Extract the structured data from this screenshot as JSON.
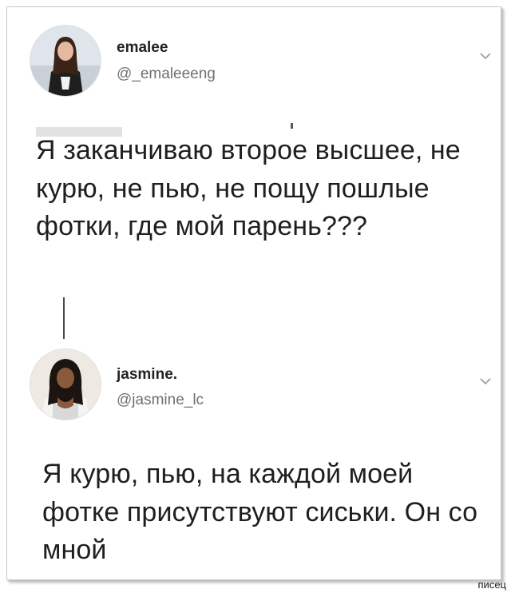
{
  "tweet1": {
    "name": "emalee",
    "handle": "@_emaleeeng",
    "text": "Я заканчиваю второе высшее, не курю, не пью, не пощу пошлые фотки, где мой парень???",
    "menu_icon": "chevron-down-icon",
    "avatar_icon": "user-photo"
  },
  "tweet2": {
    "name": "jasmine.",
    "handle": "@jasmine_lc",
    "text": "Я курю, пью, на каждой моей фотке присутствуют сиськи. Он со мной",
    "menu_icon": "chevron-down-icon",
    "avatar_icon": "user-photo"
  },
  "watermark": "писец",
  "colors": {
    "text": "#1f1f1f",
    "handle": "#707070",
    "thread_line": "#4a4a4a",
    "frame_border": "#c9c9c9"
  }
}
